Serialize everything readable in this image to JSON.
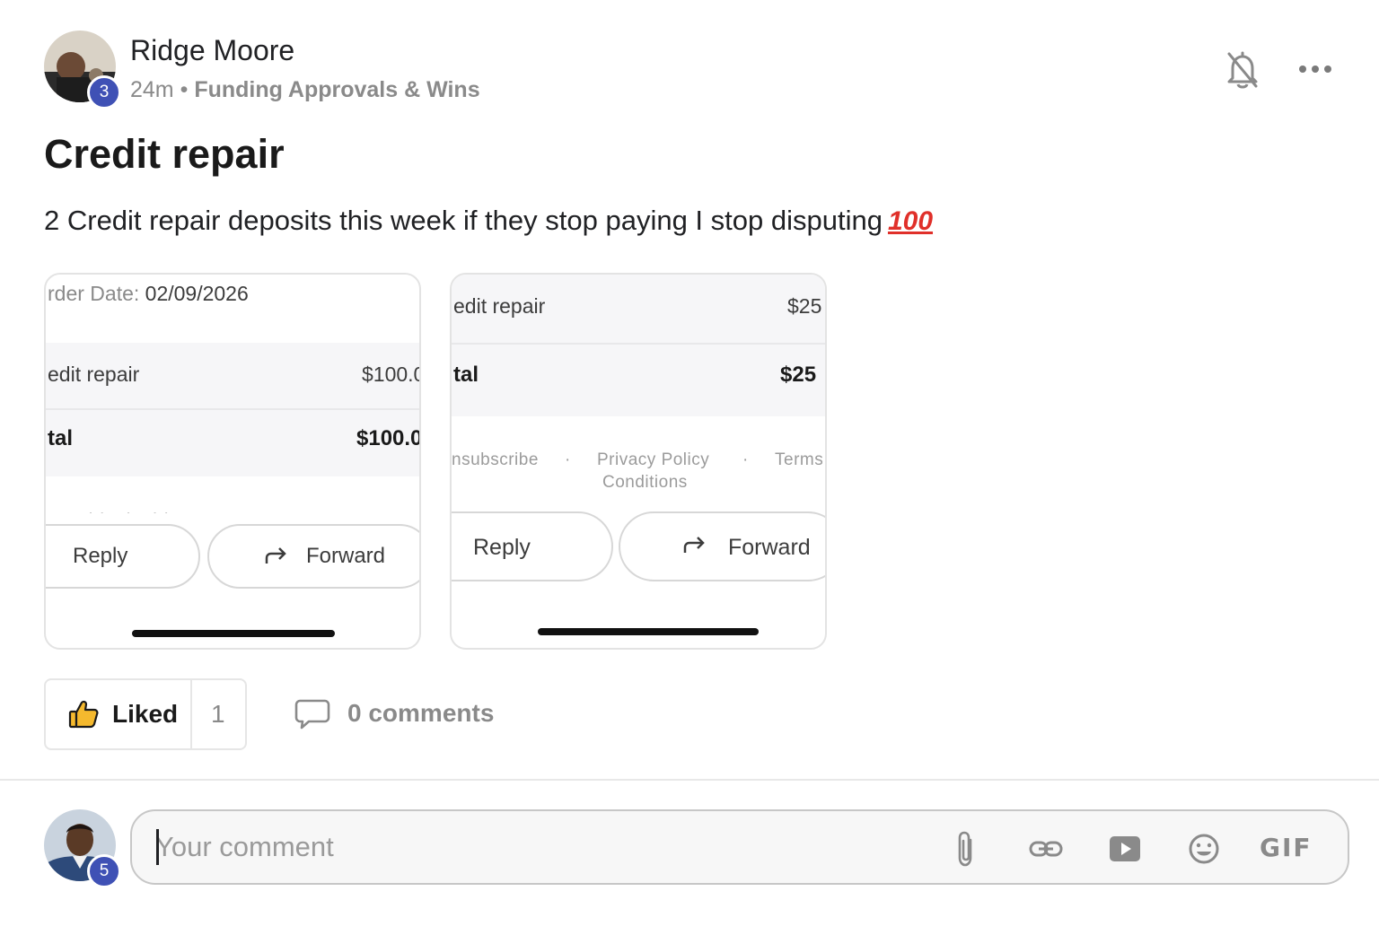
{
  "post": {
    "author": {
      "name": "Ridge Moore",
      "level": "3"
    },
    "time": "24m",
    "separator": "•",
    "category": "Funding Approvals & Wins",
    "title": "Credit repair",
    "body": "2 Credit repair deposits this week if they stop paying I stop disputing",
    "body_emoji": "100",
    "icons": {
      "bell": "bell-off-icon",
      "more": "more-horizontal-icon"
    }
  },
  "attachments": [
    {
      "order_date_label": "rder Date:",
      "order_date_value": "02/09/2026",
      "item_label": "edit repair",
      "item_value": "$100.0",
      "total_label": "tal",
      "total_value": "$100.0",
      "reply_label": "Reply",
      "forward_label": "Forward"
    },
    {
      "item_label": "edit repair",
      "item_value": "$25",
      "total_label": "tal",
      "total_value": "$25",
      "footer_unsubscribe": "nsubscribe",
      "footer_privacy": "Privacy Policy",
      "footer_terms": "Terms",
      "footer_conditions": "Conditions",
      "footer_dot": "·",
      "reply_label": "Reply",
      "forward_label": "Forward"
    }
  ],
  "actions": {
    "like_label": "Liked",
    "like_count": "1",
    "comments_label": "0 comments"
  },
  "composer": {
    "placeholder": "Your comment",
    "user_level": "5",
    "tools": [
      "paperclip-icon",
      "link-icon",
      "video-icon",
      "emoji-icon"
    ],
    "gif_label": "GIF"
  },
  "colors": {
    "accent_badge": "#3f51b5",
    "emoji_red": "#e0302a"
  }
}
